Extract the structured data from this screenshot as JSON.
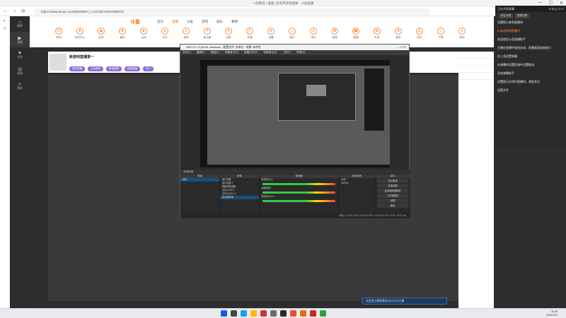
{
  "browser": {
    "window_title": "一区精选 | 直播_巴老师游戏直播 - 斗鱼直播",
    "url": "https://www.douyu.com/9600866?_t=22740131997955876",
    "nav": {
      "back": "←",
      "forward": "→",
      "reload": "⟳"
    },
    "window_buttons": {
      "minimize": "—",
      "maximize": "☐",
      "close": "✕"
    }
  },
  "leftbar": {
    "items": [
      "◐",
      "☆"
    ]
  },
  "sidenav": {
    "items": [
      {
        "icon": "⌂",
        "label": "推荐"
      },
      {
        "icon": "▶",
        "label": "直播"
      },
      {
        "icon": "♥",
        "label": "关注"
      },
      {
        "icon": "◎",
        "label": "发现"
      },
      {
        "icon": "☺",
        "label": "我的"
      }
    ]
  },
  "topnav": {
    "logo": "斗鱼",
    "links": [
      "首页",
      "直播",
      "分类",
      "游戏",
      "娱乐",
      "赛事"
    ],
    "icon_items": [
      {
        "glyph": "12",
        "label": "签到"
      },
      {
        "glyph": "★",
        "label": "任务中心"
      },
      {
        "glyph": "◆",
        "label": "会员"
      },
      {
        "glyph": "✚",
        "label": "福利"
      },
      {
        "glyph": "♣",
        "label": "活动"
      },
      {
        "glyph": "♦",
        "label": "车队"
      },
      {
        "glyph": "✈",
        "label": "鱼吧"
      },
      {
        "glyph": "☂",
        "label": "粉丝团"
      },
      {
        "glyph": "✉",
        "label": "消息"
      },
      {
        "glyph": "✎",
        "label": "开播"
      },
      {
        "glyph": "⚙",
        "label": "设置"
      },
      {
        "glyph": "♫",
        "label": "音乐"
      },
      {
        "glyph": "☀",
        "label": "排行"
      },
      {
        "glyph": "✪",
        "label": "商城"
      },
      {
        "glyph": "☎",
        "label": "客服"
      },
      {
        "glyph": "✿",
        "label": "礼物"
      },
      {
        "glyph": "❖",
        "label": "更多"
      },
      {
        "glyph": "☰",
        "label": "历史"
      },
      {
        "glyph": "☼",
        "label": "下载"
      },
      {
        "glyph": "✦",
        "label": "我的"
      }
    ]
  },
  "streamer": {
    "name": "新游戏直播第一",
    "tags": [
      "游戏直播",
      "主机游戏",
      "新游推荐",
      "精品直播",
      "热门"
    ]
  },
  "chat_input_hint": "这里是主播直播间|点击关注主播",
  "share_overlay": {
    "header": "正在共享屏幕",
    "header_buttons": [
      "⊟",
      "⊞",
      "◱",
      "⊡",
      "✕"
    ],
    "actions": [
      "停止共享",
      "暂停共享"
    ],
    "messages": [
      {
        "text": "设置提示来到直播间",
        "hl": false
      },
      {
        "text": "● 欢迎来到直播间",
        "hl": true
      },
      {
        "text": "欢迎使用斗鱼直播助手",
        "hl": false
      },
      {
        "text": "主播在直播中请勿关闭，直播画面会被放大",
        "hl": false
      },
      {
        "text": "在上角设置弹幕",
        "hl": false
      },
      {
        "text": "在弹幕的设置区域中设置推流",
        "hl": false
      },
      {
        "text": "添加弹幕助手",
        "hl": false
      },
      {
        "text": "设置提示在你们直播间，请您关注",
        "hl": false
      },
      {
        "text": "设置文件",
        "hl": false
      }
    ]
  },
  "obs": {
    "title": "OBS 27.1.3 (64 bit, windows) - 配置文件: 未命名 - 场景: 未命名",
    "window_buttons": "— ☐ ✕",
    "menu": [
      "文件(F)",
      "编辑(E)",
      "视图(V)",
      "停靠窗口(D)",
      "配置文件(P)",
      "场景集合(S)",
      "工具(T)",
      "帮助(H)"
    ],
    "scene_bar": "未选择源",
    "docks": {
      "scenes": {
        "header": "场景",
        "items": [
          "场景"
        ]
      },
      "sources": {
        "header": "来源",
        "items": [
          "窗口采集",
          "窗口采集 2",
          "视频采集设备",
          "文本 (GDI+)",
          "文本 (GDI+) 2",
          "显示器采集"
        ]
      },
      "mixer": {
        "header": "混音器",
        "channels": [
          "麦克风/Aux",
          "桌面音频",
          "麦克风/Aux 2"
        ]
      },
      "transitions": {
        "header": "转场特效",
        "type": "淡出",
        "duration": "300 ms"
      },
      "controls": {
        "header": "控件",
        "buttons": [
          "停止推流",
          "开始录制",
          "启动虚拟摄像机",
          "工作室模式",
          "设置",
          "退出"
        ]
      }
    },
    "status": "掉帧 0 (0.0%)   LIVE: 00:00:00   REC: 00:00:00   CPU: 4.9%, 60.00 fps"
  },
  "taskbar": {
    "app_colors": [
      "#0a64d6",
      "#444",
      "#1aa0e0",
      "#ffb900",
      "#d13438",
      "#6b6b6b",
      "#2b2b2b",
      "#e5503a",
      "#e56a1a",
      "#c42b1c",
      "#2ea043"
    ],
    "time": "16:36",
    "date": "2022/1/24"
  },
  "colors": {
    "accent": "#ff6a00",
    "page_dark": "#2d2d2d",
    "obs_bg": "#2b2b2b"
  }
}
